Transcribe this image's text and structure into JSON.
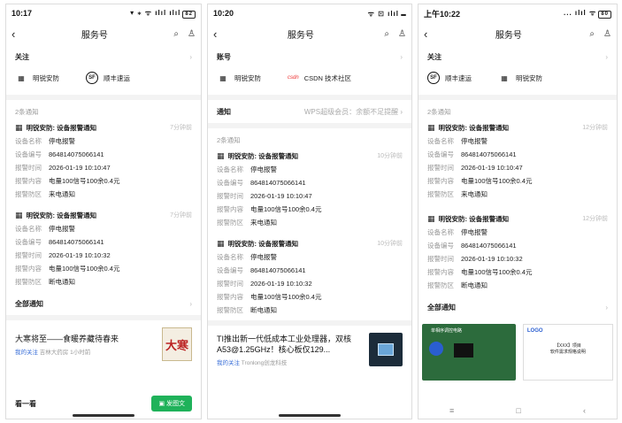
{
  "notice_fields_labels": {
    "name": "设备名称",
    "id": "设备编号",
    "time": "报警时间",
    "content": "报警内容",
    "zone": "报警防区"
  },
  "p1": {
    "status": {
      "time": "10:17",
      "right": "▾ ⁎ ᯤ ılıl ılıl",
      "battery": "82"
    },
    "nav": {
      "title": "服务号"
    },
    "follow": "关注",
    "acc1": "明锐安防",
    "acc2": "顺丰速运",
    "count": "2条通知",
    "n1": {
      "title": "明锐安防: 设备报警通知",
      "time": "7分钟前",
      "name": "停电报警",
      "id": "864814075066141",
      "atime": "2026-01-19 10:10:47",
      "content": "电量100信号100余0.4元",
      "zone": "来电通知"
    },
    "n2": {
      "title": "明锐安防: 设备报警通知",
      "time": "7分钟前",
      "name": "停电报警",
      "id": "864814075066141",
      "atime": "2026-01-19 10:10:32",
      "content": "电量100信号100余0.4元",
      "zone": "断电通知"
    },
    "all": "全部通知",
    "article": {
      "title": "大寒将至——食暖养藏待春来",
      "mine": "我的关注",
      "meta": " 吉林大药房 1小时前",
      "thumb": "大寒"
    },
    "look": "看一看",
    "btn": "发图文"
  },
  "p2": {
    "status": {
      "time": "10:20",
      "right": "ᯤ ⊡ ılıl",
      "battery": ""
    },
    "nav": {
      "title": "服务号"
    },
    "account": "账号",
    "acc1": "明锐安防",
    "csdn_logo": "csdn",
    "acc2": "CSDN 技术社区",
    "notify": "通知",
    "notify_sub": "WPS超级会员：余额不足提醒",
    "count": "2条通知",
    "n1": {
      "title": "明锐安防: 设备报警通知",
      "time": "10分钟前",
      "name": "停电报警",
      "id": "864814075066141",
      "atime": "2026-01-19 10:10:47",
      "content": "电量100信号100余0.4元",
      "zone": "来电通知"
    },
    "n2": {
      "title": "明锐安防: 设备报警通知",
      "time": "10分钟前",
      "name": "停电报警",
      "id": "864814075066141",
      "atime": "2026-01-19 10:10:32",
      "content": "电量100信号100余0.4元",
      "zone": "断电通知"
    },
    "article": {
      "title": "TI推出新一代低成本工业处理器，双核A53@1.25GHz！核心板仅129...",
      "mine": "我的关注",
      "meta": " Tronlong创龙科技"
    }
  },
  "p3": {
    "status": {
      "time": "上午10:22",
      "right": "... ılıl ᯤ",
      "battery": "80"
    },
    "nav": {
      "title": "服务号"
    },
    "follow": "关注",
    "acc1": "顺丰速运",
    "acc2": "明锐安防",
    "count": "2条通知",
    "n1": {
      "title": "明锐安防: 设备报警通知",
      "time": "12分钟前",
      "name": "停电报警",
      "id": "864814075066141",
      "atime": "2026-01-19 10:10:47",
      "content": "电量100信号100余0.4元",
      "zone": "来电通知"
    },
    "n2": {
      "title": "明锐安防: 设备报警通知",
      "time": "12分钟前",
      "name": "停电报警",
      "id": "864814075066141",
      "atime": "2026-01-19 10:10:32",
      "content": "电量100信号100余0.4元",
      "zone": "断电通知"
    },
    "all": "全部通知",
    "img1_label": "单相序调控电路",
    "img2": {
      "logo": "LOGO",
      "line1": "【XXX】项目",
      "line2": "软件需求规格说明"
    },
    "nav_icons": {
      "menu": "≡",
      "home": "□",
      "back": "‹"
    }
  }
}
